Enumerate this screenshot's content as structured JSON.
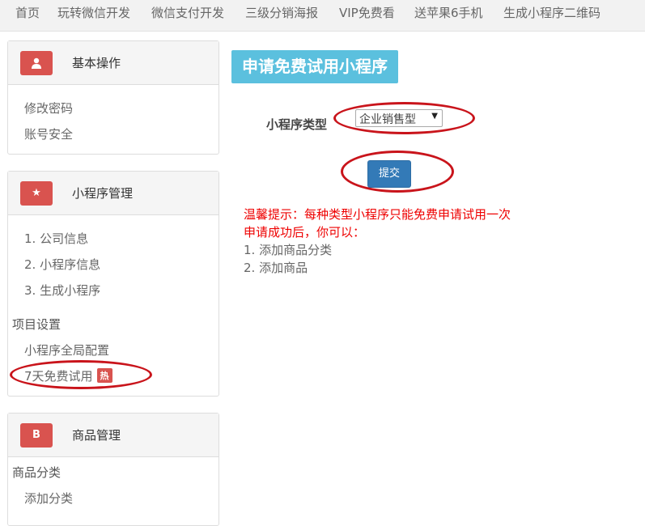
{
  "topnav": {
    "items": [
      "首页",
      "玩转微信开发",
      "微信支付开发",
      "三级分销海报",
      "VIP免费看",
      "送苹果6手机",
      "生成小程序二维码"
    ]
  },
  "sidebar": {
    "basic": {
      "icon": "user-icon",
      "icon_glyph": "👤",
      "title": "基本操作",
      "links": [
        "修改密码",
        "账号安全"
      ]
    },
    "miniprogram": {
      "icon": "star-icon",
      "icon_glyph": "★",
      "title": "小程序管理",
      "links": [
        "1. 公司信息",
        "2. 小程序信息",
        "3. 生成小程序"
      ],
      "section": "项目设置",
      "section_links": [
        "小程序全局配置",
        "7天免费试用"
      ],
      "hot_badge": "热"
    },
    "goods": {
      "icon": "bitcoin-icon",
      "icon_glyph": "B",
      "title": "商品管理",
      "section": "商品分类",
      "links": [
        "添加分类"
      ]
    }
  },
  "main": {
    "title": "申请免费试用小程序",
    "type_label": "小程序类型",
    "type_value": "企业销售型",
    "submit_label": "提交",
    "tips": [
      "温馨提示：每种类型小程序只能免费申请试用一次",
      "申请成功后，你可以：",
      "1. 添加商品分类",
      "2. 添加商品"
    ]
  },
  "colors": {
    "accent": "#5bc0de",
    "primary_button": "#337ab7",
    "badge": "#d9534f",
    "annotation": "#c9141b",
    "warning_text": "#ee0000"
  }
}
